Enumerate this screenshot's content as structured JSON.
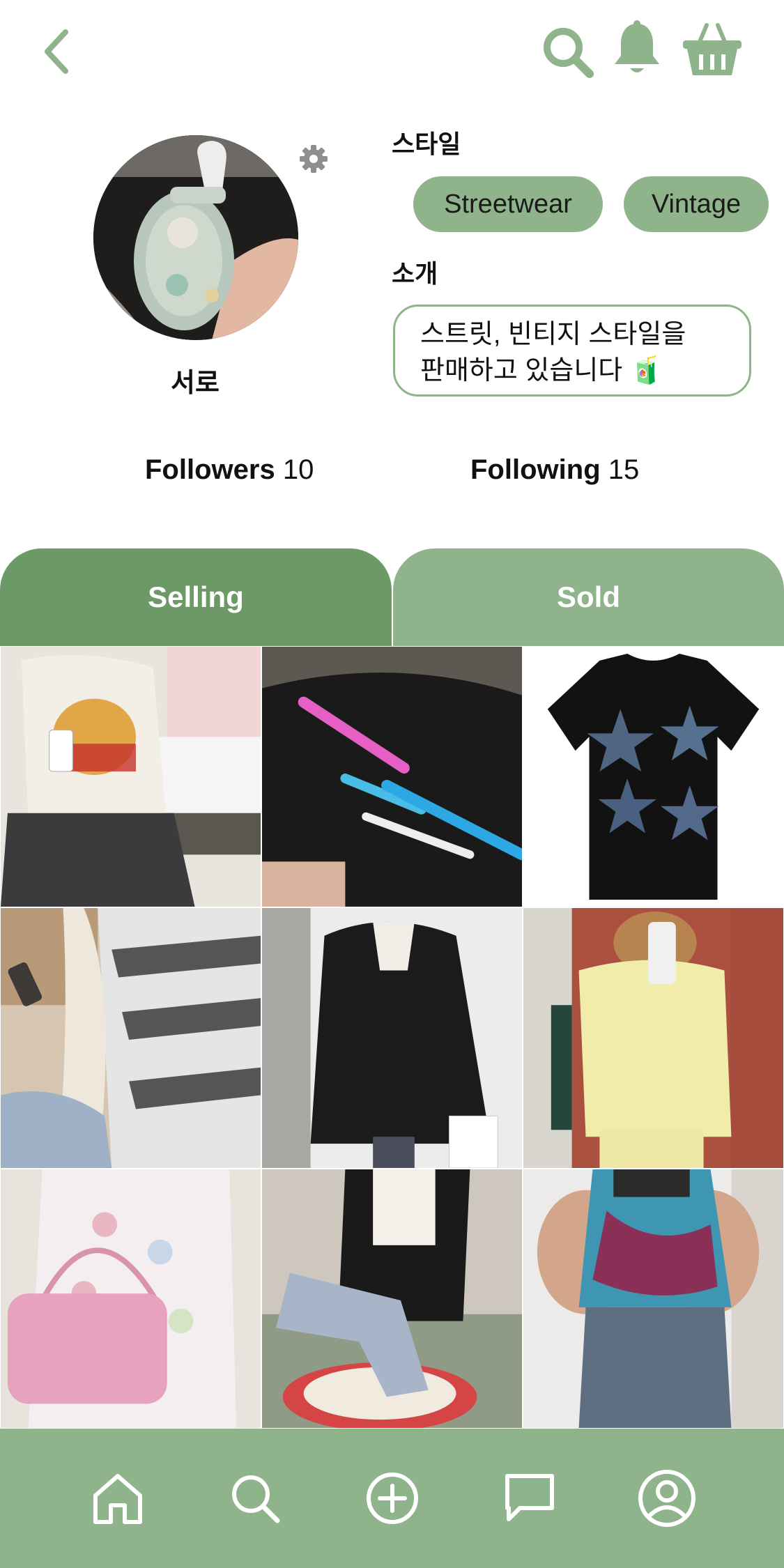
{
  "header": {
    "back_icon": "chevron-left-icon",
    "actions": [
      "search-icon",
      "bell-icon",
      "basket-icon"
    ]
  },
  "profile": {
    "username": "서로",
    "settings_icon": "gear-icon",
    "style_label": "스타일",
    "tags": [
      "Streetwear",
      "Vintage"
    ],
    "intro_label": "소개",
    "bio_line1": "스트릿, 빈티지 스타일을",
    "bio_line2": "판매하고 있습니다",
    "bio_emoji": "🧃"
  },
  "stats": {
    "followers_label": "Followers",
    "followers_count": "10",
    "following_label": "Following",
    "following_count": "15"
  },
  "tabs": {
    "selling": "Selling",
    "sold": "Sold"
  },
  "colors": {
    "accent": "#8fb38a",
    "accent_dark": "#6b9a66",
    "text": "#111111"
  },
  "products": [
    "graphic-tee-skirt-photo",
    "hair-clips-photo",
    "black-star-tee-photo",
    "striped-sweater-scarf-photo",
    "black-leather-jacket-photo",
    "yellow-shirt-photo",
    "pink-bag-cardigan-photo",
    "black-blazer-jeans-photo",
    "tie-dye-tank-photo"
  ],
  "bottom_nav": [
    "home-icon",
    "search-icon",
    "add-icon",
    "chat-icon",
    "profile-icon"
  ]
}
